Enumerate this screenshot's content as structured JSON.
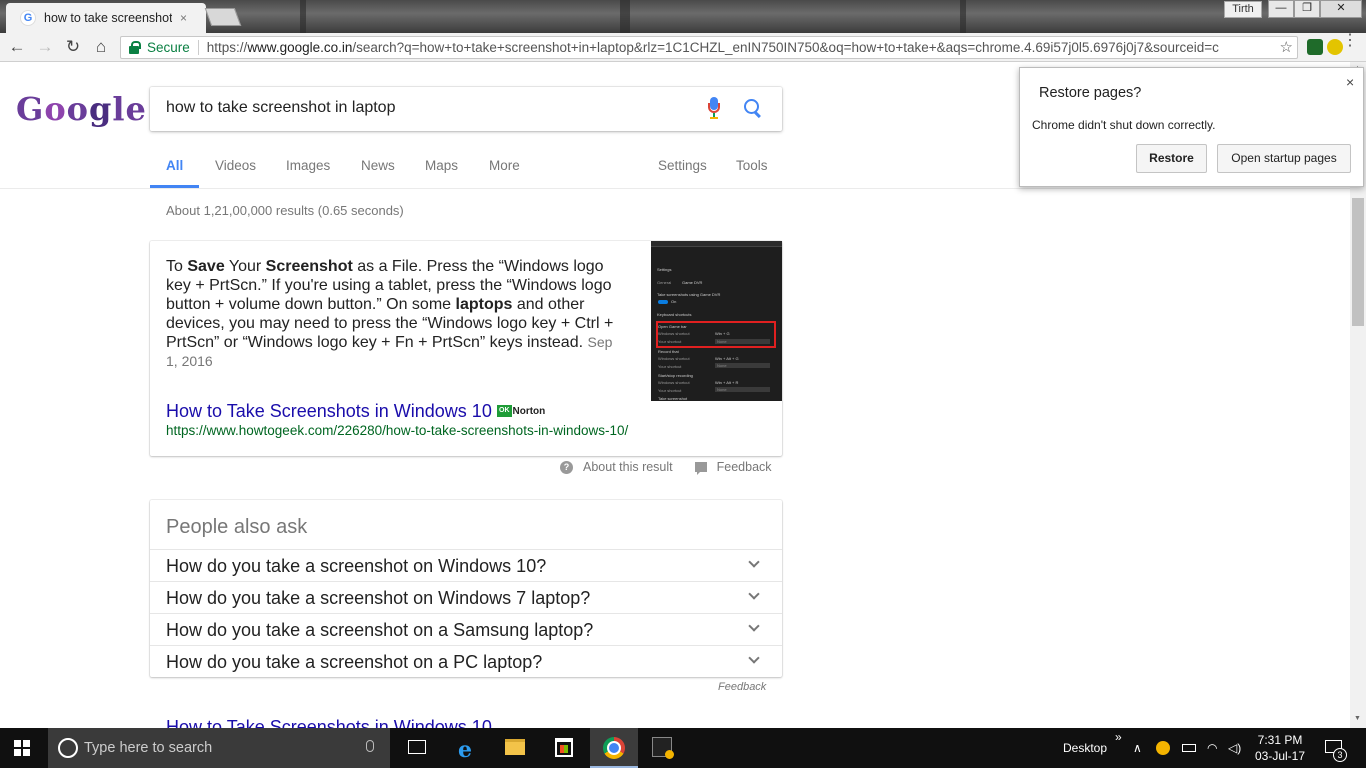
{
  "browser": {
    "tab_title": "how to take screenshot i",
    "tab_favicon": "G",
    "tab_close": "×",
    "profile_name": "Tirth",
    "secure_label": "Secure",
    "url_scheme": "https://",
    "url_host": "www.google.co.in",
    "url_rest": "/search?q=how+to+take+screenshot+in+laptop&rlz=1C1CHZL_enIN750IN750&oq=how+to+take+&aqs=chrome.4.69i57j0l5.6976j0j7&sourceid=c",
    "back_icon": "←",
    "forward_icon": "→",
    "reload_icon": "↻",
    "home_icon": "⌂",
    "bookmark_icon": "☆",
    "minimize_icon": "—",
    "maximize_icon": "❐",
    "close_icon": "✕",
    "menu_icon": "⋮"
  },
  "google": {
    "logo_letters": [
      "G",
      "o",
      "o",
      "g",
      "l",
      "e"
    ],
    "query": "how to take screenshot in laptop",
    "tabs": [
      "All",
      "Videos",
      "Images",
      "News",
      "Maps",
      "More"
    ],
    "tools": [
      "Settings",
      "Tools"
    ],
    "active_tab": "All",
    "accent": "#4285f4"
  },
  "results": {
    "stats": "About 1,21,00,000 results (0.65 seconds)",
    "featured": {
      "snippet": [
        {
          "t": "To ",
          "b": false
        },
        {
          "t": "Save",
          "b": true
        },
        {
          "t": " Your ",
          "b": false
        },
        {
          "t": "Screenshot",
          "b": true
        },
        {
          "t": " as a File. Press the “Windows logo key + PrtScn.” If you're using a tablet, press the “Windows logo button + volume down button.” On some ",
          "b": false
        },
        {
          "t": "laptops",
          "b": true
        },
        {
          "t": " and other devices, you may need to press the “Windows logo key + Ctrl + PrtScn” or “Windows logo key + Fn + PrtScn” keys instead. ",
          "b": false
        }
      ],
      "date": "Sep 1, 2016",
      "title": "How to Take Screenshots in Windows 10",
      "badge_ok": "OK",
      "badge_name": "Norton",
      "url": "https://www.howtogeek.com/226280/how-to-take-screenshots-in-windows-10/",
      "thumbnail": {
        "settings": "Settings",
        "general": "General",
        "gamedvr": "Game DVR",
        "take_label": "Take screenshots using Game DVR",
        "on": "On",
        "keyboard": "Keyboard shortcuts",
        "open_game_bar": "Open Game bar",
        "windows_shortcut": "Windows shortcut",
        "win_g": "Win + G",
        "your_shortcut": "Your shortcut",
        "none": "None",
        "record_that": "Record that",
        "win_alt_g": "Win + Alt + G",
        "start_stop": "Start/stop recording",
        "win_alt_r": "Win + Alt + R",
        "take_screenshot": "Take screenshot"
      }
    },
    "about_label": "About this result",
    "feedback_label": "Feedback",
    "paa": {
      "title": "People also ask",
      "questions": [
        "How do you take a screenshot on Windows 10?",
        "How do you take a screenshot on Windows 7 laptop?",
        "How do you take a screenshot on a Samsung laptop?",
        "How do you take a screenshot on a PC laptop?"
      ],
      "feedback": "Feedback"
    },
    "next_title": "How to Take Screenshots in Windows 10"
  },
  "popup": {
    "title": "Restore pages?",
    "message": "Chrome didn't shut down correctly.",
    "restore": "Restore",
    "open_startup": "Open startup pages",
    "close": "×"
  },
  "taskbar": {
    "search_placeholder": "Type here to search",
    "desktop_label": "Desktop",
    "overflow_chevron": "»",
    "tray_up": "∧",
    "time": "7:31 PM",
    "date": "03-Jul-17",
    "notification_count": "3"
  }
}
